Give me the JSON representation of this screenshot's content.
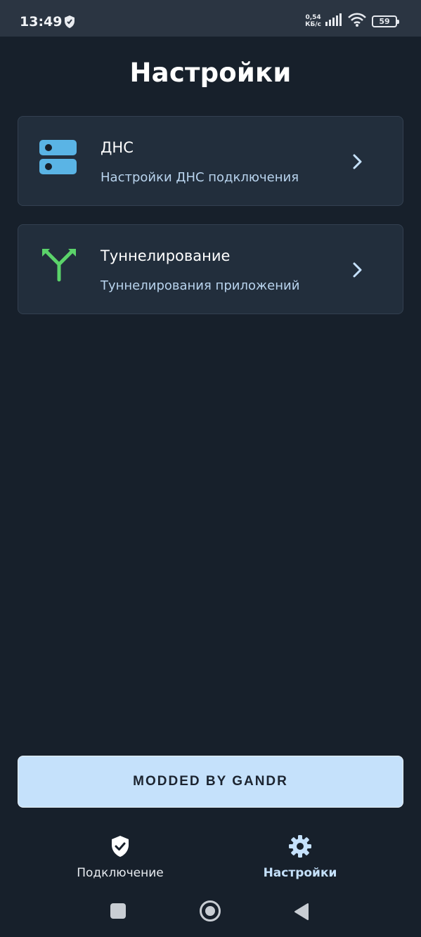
{
  "status_bar": {
    "time": "13:49",
    "net_speed_value": "0,54",
    "net_speed_unit": "КБ/с",
    "battery": "59"
  },
  "header": {
    "title": "Настройки"
  },
  "settings": [
    {
      "title": "ДНС",
      "subtitle": "Настройки ДНС подключения",
      "icon": "server-icon",
      "icon_color": "#5ab4e5"
    },
    {
      "title": "Туннелирование",
      "subtitle": "Туннелирования приложений",
      "icon": "fork-arrows-icon",
      "icon_color": "#5bd36a"
    }
  ],
  "mod_button": {
    "label": "MODDED BY GANDR"
  },
  "bottom_nav": {
    "items": [
      {
        "label": "Подключение",
        "icon": "shield-check-icon"
      },
      {
        "label": "Настройки",
        "icon": "gear-icon",
        "active": true
      }
    ]
  },
  "colors": {
    "background": "#17202b",
    "card": "#222e3c",
    "accent": "#c5e1fb",
    "subtitle": "#b9d4ee"
  }
}
